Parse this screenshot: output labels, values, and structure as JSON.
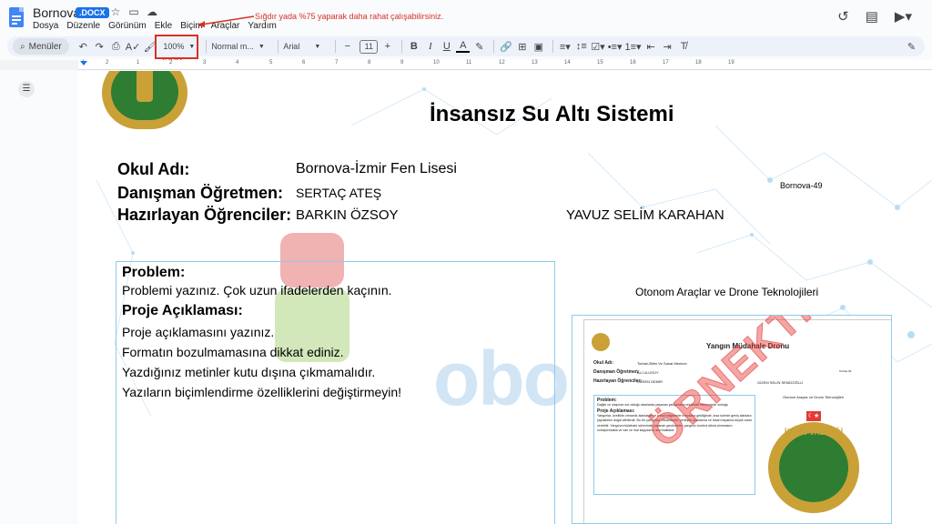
{
  "titlebar": {
    "doc_title": "Bornova",
    "doc_badge": ".DOCX",
    "menus": [
      "Dosya",
      "Düzenle",
      "Görünüm",
      "Ekle",
      "Biçim",
      "Araçlar",
      "Yardım"
    ]
  },
  "annotation": {
    "tip": "Sığdır yada %75 yaparak daha rahat çalışabilirsiniz.",
    "zoom_label": "ZOOM"
  },
  "toolbar": {
    "menus_search": "Menüler",
    "zoom": "100%",
    "style": "Normal m...",
    "font": "Arial",
    "font_size": "11",
    "bold": "B",
    "italic": "I",
    "underline": "U",
    "text_color": "A"
  },
  "ruler": {
    "ticks": [
      "1",
      "2",
      "1",
      "2",
      "3",
      "4",
      "5",
      "6",
      "7",
      "8",
      "9",
      "10",
      "11",
      "12",
      "13",
      "14",
      "15",
      "16",
      "17",
      "18",
      "19"
    ]
  },
  "document": {
    "title": "İnsansız Su Altı Sistemi",
    "school_label": "Okul Adı:",
    "school_value": "Bornova-İzmir Fen Lisesi",
    "advisor_label": "Danışman Öğretmen:",
    "advisor_value": "SERTAÇ ATEŞ",
    "students_label": "Hazırlayan Öğrenciler:",
    "student1": "BARKIN ÖZSOY",
    "student2": "YAVUZ SELİM KARAHAN",
    "tag": "Bornova-49",
    "problem_head": "Problem:",
    "problem_text": "Problemi yazınız. Çok uzun ifadelerden kaçının.",
    "desc_head": "Proje Açıklaması:",
    "desc_lines": [
      "Proje açıklamasını yazınız.",
      "Formatın bozulmamasına dikkat ediniz.",
      "Yazdığınız metinler kutu dışına çıkmamalıdır.",
      "Yazıların biçimlendirme özelliklerini değiştirmeyin!"
    ],
    "category": "Otonom Araçlar ve Drone Teknolojileri",
    "watermark": "obo"
  },
  "thumbnail": {
    "title": "Yangın Müdahale Dronu",
    "school_label": "Okul Adı:",
    "school_value": "Torbalı-Bilim Ve Sanat Merkezi",
    "advisor_label": "Danışman Öğretmen:",
    "advisor_value": "ALİ ULUSOY",
    "students_label": "Hazırlayan Öğrenciler:",
    "student1": "CEREN DEMİR",
    "student2": "GİZEM SELİN SEMİZOĞLU",
    "tag": "Torbalı-39",
    "category": "Otonom Araçlar ve Drone Teknolojileri",
    "problem_head": "Problem:",
    "problem_text": "Dağlık ve ulaşımın zor olduğu alanlarda yaşanan yangınlara müdahale edilmesinin zorluğu",
    "desc_head": "Proje Açıklaması:",
    "desc_text": "Yangınlar, özellikle ormanlık alanlarda ve kırsal bölgelerde meydana geldiğinde, kısa sürede geniş alanlara yayılabilen doğal afetlerdir. Bu tür yangınlar, ekosisteme, yerleşim alanlarına ve insan hayatına büyük zarar verebilir. Yangına müdahale sürecinde yaşanan gecikmeler, yangının kontrol altına alınmasını zorlaştırmakta ve can ve mal kayıplarını artırmaktadır.",
    "seal_text": "İZMİR VALİLİĞİ",
    "stamp": "ÖRNEKTİR"
  },
  "colors": {
    "accent": "#1a73e8",
    "annotation": "#d93025",
    "box_border": "#8fcae8"
  }
}
